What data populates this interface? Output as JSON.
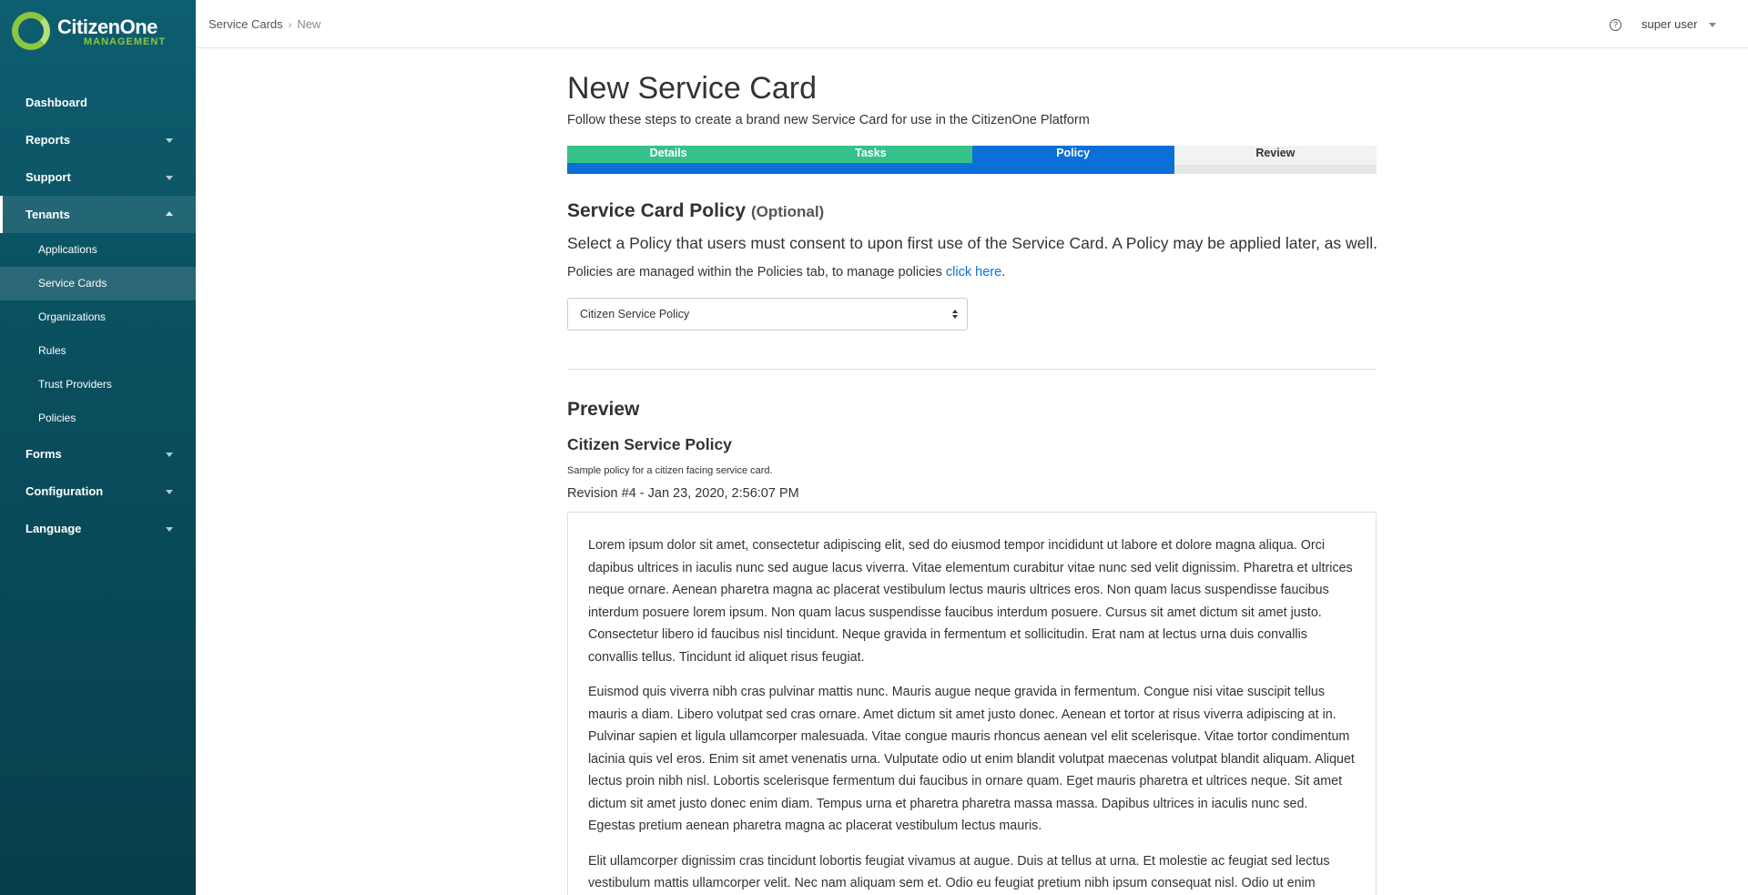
{
  "brand": {
    "name": "CitizenOne",
    "tagline": "MANAGEMENT",
    "colors": {
      "sidebar": "#0a4f5f",
      "accent_green": "#8cc63f",
      "primary_blue": "#0a6fd6",
      "step_done": "#35c28a"
    }
  },
  "sidebar": {
    "items": [
      {
        "label": "Dashboard",
        "icon": ""
      },
      {
        "label": "Reports",
        "icon": "chevron-down-icon"
      },
      {
        "label": "Support",
        "icon": "chevron-down-icon"
      },
      {
        "label": "Tenants",
        "icon": "chevron-up-icon",
        "expanded": true
      },
      {
        "label": "Forms",
        "icon": "chevron-down-icon"
      },
      {
        "label": "Configuration",
        "icon": "chevron-down-icon"
      },
      {
        "label": "Language",
        "icon": "chevron-down-icon"
      }
    ],
    "tenants_sub": [
      {
        "label": "Applications"
      },
      {
        "label": "Service Cards",
        "active": true
      },
      {
        "label": "Organizations"
      },
      {
        "label": "Rules"
      },
      {
        "label": "Trust Providers"
      },
      {
        "label": "Policies"
      }
    ]
  },
  "topbar": {
    "breadcrumb": [
      "Service Cards",
      "New"
    ],
    "help_icon": "question-circle-icon",
    "user": "super user"
  },
  "page": {
    "title": "New Service Card",
    "subtitle": "Follow these steps to create a brand new Service Card for use in the CitizenOne Platform",
    "steps": [
      {
        "label": "Details",
        "state": "done"
      },
      {
        "label": "Tasks",
        "state": "done"
      },
      {
        "label": "Policy",
        "state": "current"
      },
      {
        "label": "Review",
        "state": "todo"
      }
    ],
    "section_title": "Service Card Policy",
    "section_optional": "(Optional)",
    "lead": "Select a Policy that users must consent to upon first use of the Service Card. A Policy may be applied later, as well.",
    "note_prefix": "Policies are managed within the Policies tab, to manage policies ",
    "note_link": "click here",
    "note_suffix": ".",
    "policy_select": {
      "value": "Citizen Service Policy"
    },
    "preview": {
      "heading": "Preview",
      "policy_name": "Citizen Service Policy",
      "policy_description": "Sample policy for a citizen facing service card.",
      "revision": "Revision #4 - Jan 23, 2020, 2:56:07 PM",
      "paragraphs": [
        "Lorem ipsum dolor sit amet, consectetur adipiscing elit, sed do eiusmod tempor incididunt ut labore et dolore magna aliqua. Orci dapibus ultrices in iaculis nunc sed augue lacus viverra. Vitae elementum curabitur vitae nunc sed velit dignissim. Pharetra et ultrices neque ornare. Aenean pharetra magna ac placerat vestibulum lectus mauris ultrices eros. Non quam lacus suspendisse faucibus interdum posuere lorem ipsum. Non quam lacus suspendisse faucibus interdum posuere. Cursus sit amet dictum sit amet justo. Consectetur libero id faucibus nisl tincidunt. Neque gravida in fermentum et sollicitudin. Erat nam at lectus urna duis convallis convallis tellus. Tincidunt id aliquet risus feugiat.",
        "Euismod quis viverra nibh cras pulvinar mattis nunc. Mauris augue neque gravida in fermentum. Congue nisi vitae suscipit tellus mauris a diam. Libero volutpat sed cras ornare. Amet dictum sit amet justo donec. Aenean et tortor at risus viverra adipiscing at in. Pulvinar sapien et ligula ullamcorper malesuada. Vitae congue mauris rhoncus aenean vel elit scelerisque. Vitae tortor condimentum lacinia quis vel eros. Enim sit amet venenatis urna. Vulputate odio ut enim blandit volutpat maecenas volutpat blandit aliquam. Aliquet lectus proin nibh nisl. Lobortis scelerisque fermentum dui faucibus in ornare quam. Eget mauris pharetra et ultrices neque. Sit amet dictum sit amet justo donec enim diam. Tempus urna et pharetra pharetra massa massa. Dapibus ultrices in iaculis nunc sed. Egestas pretium aenean pharetra magna ac placerat vestibulum lectus mauris.",
        "Elit ullamcorper dignissim cras tincidunt lobortis feugiat vivamus at augue. Duis at tellus at urna. Et molestie ac feugiat sed lectus vestibulum mattis ullamcorper velit. Nec nam aliquam sem et. Odio eu feugiat pretium nibh ipsum consequat nisl. Odio ut enim"
      ]
    }
  }
}
